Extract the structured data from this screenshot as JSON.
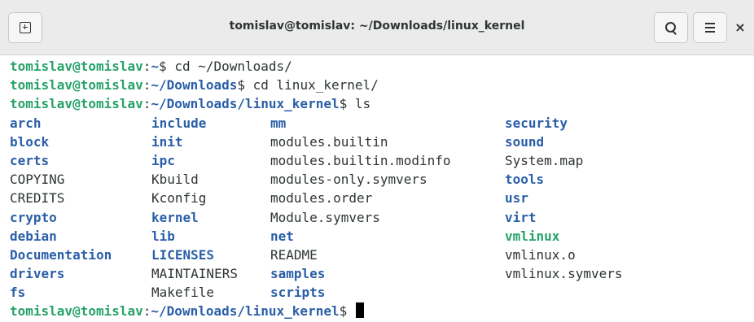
{
  "window": {
    "title": "tomislav@tomislav: ~/Downloads/linux_kernel",
    "close_glyph": "×",
    "icons": [
      "new-tab-icon",
      "search-icon",
      "hamburger-menu-icon",
      "close-icon"
    ]
  },
  "colors": {
    "prompt_user": "#26a269",
    "prompt_path": "#2a5ea8",
    "directory": "#2a5ea8",
    "executable": "#26a269",
    "text": "#2e3436"
  },
  "terminal": {
    "history": [
      {
        "user": "tomislav@tomislav",
        "sep": ":",
        "path": "~",
        "suffix": "$ cd ~/Downloads/"
      },
      {
        "user": "tomislav@tomislav",
        "sep": ":",
        "path": "~/Downloads",
        "suffix": "$ cd linux_kernel/"
      },
      {
        "user": "tomislav@tomislav",
        "sep": ":",
        "path": "~/Downloads/linux_kernel",
        "suffix": "$ ls"
      }
    ],
    "ls_rows": [
      [
        {
          "name": "arch",
          "kind": "dir"
        },
        {
          "name": "include",
          "kind": "dir"
        },
        {
          "name": "mm",
          "kind": "dir"
        },
        {
          "name": "security",
          "kind": "dir"
        }
      ],
      [
        {
          "name": "block",
          "kind": "dir"
        },
        {
          "name": "init",
          "kind": "dir"
        },
        {
          "name": "modules.builtin",
          "kind": "file"
        },
        {
          "name": "sound",
          "kind": "dir"
        }
      ],
      [
        {
          "name": "certs",
          "kind": "dir"
        },
        {
          "name": "ipc",
          "kind": "dir"
        },
        {
          "name": "modules.builtin.modinfo",
          "kind": "file"
        },
        {
          "name": "System.map",
          "kind": "file"
        }
      ],
      [
        {
          "name": "COPYING",
          "kind": "file"
        },
        {
          "name": "Kbuild",
          "kind": "file"
        },
        {
          "name": "modules-only.symvers",
          "kind": "file"
        },
        {
          "name": "tools",
          "kind": "dir"
        }
      ],
      [
        {
          "name": "CREDITS",
          "kind": "file"
        },
        {
          "name": "Kconfig",
          "kind": "file"
        },
        {
          "name": "modules.order",
          "kind": "file"
        },
        {
          "name": "usr",
          "kind": "dir"
        }
      ],
      [
        {
          "name": "crypto",
          "kind": "dir"
        },
        {
          "name": "kernel",
          "kind": "dir"
        },
        {
          "name": "Module.symvers",
          "kind": "file"
        },
        {
          "name": "virt",
          "kind": "dir"
        }
      ],
      [
        {
          "name": "debian",
          "kind": "dir"
        },
        {
          "name": "lib",
          "kind": "dir"
        },
        {
          "name": "net",
          "kind": "dir"
        },
        {
          "name": "vmlinux",
          "kind": "exe"
        }
      ],
      [
        {
          "name": "Documentation",
          "kind": "dir"
        },
        {
          "name": "LICENSES",
          "kind": "dir"
        },
        {
          "name": "README",
          "kind": "file"
        },
        {
          "name": "vmlinux.o",
          "kind": "file"
        }
      ],
      [
        {
          "name": "drivers",
          "kind": "dir"
        },
        {
          "name": "MAINTAINERS",
          "kind": "file"
        },
        {
          "name": "samples",
          "kind": "dir"
        },
        {
          "name": "vmlinux.symvers",
          "kind": "file"
        }
      ],
      [
        {
          "name": "fs",
          "kind": "dir"
        },
        {
          "name": "Makefile",
          "kind": "file"
        },
        {
          "name": "scripts",
          "kind": "dir"
        },
        {
          "name": "",
          "kind": "file"
        }
      ]
    ],
    "current_prompt": {
      "user": "tomislav@tomislav",
      "sep": ":",
      "path": "~/Downloads/linux_kernel",
      "suffix": "$ "
    }
  }
}
